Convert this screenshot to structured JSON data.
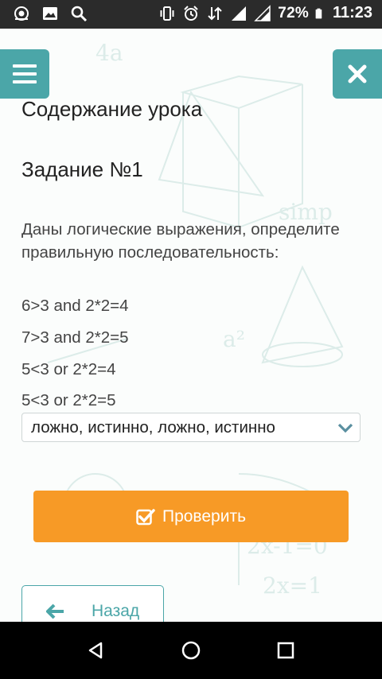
{
  "status_bar": {
    "battery": "72%",
    "time": "11:23",
    "icons": [
      "camera-lens-icon",
      "image-icon",
      "search-icon",
      "vibrate-icon",
      "alarm-icon",
      "data-arrows-icon",
      "signal-icon",
      "signal-icon",
      "battery-icon"
    ]
  },
  "header": {
    "menu_icon": "hamburger-icon",
    "close_icon": "close-icon"
  },
  "lesson": {
    "title": "Содержание урока"
  },
  "task": {
    "title": "Задание №1",
    "description": "Даны логические выражения, определите правильную последовательность:",
    "expressions": [
      "6>3 and 2*2=4",
      "7>3 and 2*2=5",
      "5<3 or 2*2=4",
      "5<3 or 2*2=5"
    ]
  },
  "answer_select": {
    "value": "ложно, истинно, ложно, истинно"
  },
  "check_button": {
    "label": "Проверить",
    "icon": "checkbox-icon"
  },
  "back_button": {
    "label": "Назад",
    "icon": "arrow-left-icon"
  },
  "nav_bar": {
    "icons": [
      "back-triangle-icon",
      "home-circle-icon",
      "recents-square-icon"
    ]
  },
  "colors": {
    "teal": "#4ba6a8",
    "orange": "#f79a26",
    "status_bar": "#2b2b2b"
  }
}
